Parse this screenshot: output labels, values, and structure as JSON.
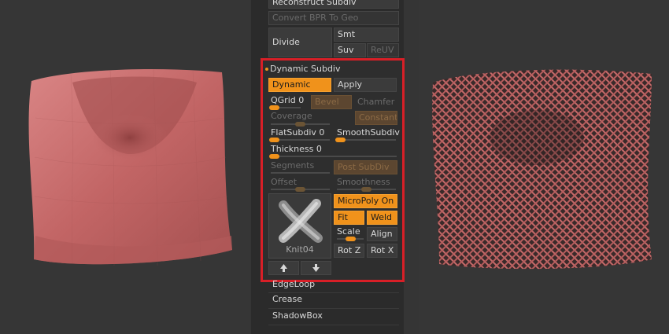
{
  "panel": {
    "top_items": [
      {
        "label": "Reconstruct Subdiv",
        "enabled": true
      },
      {
        "label": "Convert BPR To Geo",
        "enabled": false
      }
    ],
    "divide": {
      "label": "Divide",
      "smt": "Smt",
      "suv": "Suv",
      "reuv": "ReUV"
    },
    "dynamic_subdiv": {
      "title": "Dynamic Subdiv",
      "dynamic_label": "Dynamic",
      "apply_label": "Apply",
      "qgrid_label": "QGrid",
      "qgrid_value": "0",
      "bevel_label": "Bevel",
      "chamfer_label": "Chamfer",
      "coverage_label": "Coverage",
      "constant_label": "Constant",
      "flat_label": "FlatSubdiv",
      "flat_value": "0",
      "smooth_subdiv_label": "SmoothSubdiv",
      "thickness_label": "Thickness",
      "thickness_value": "0",
      "segments_label": "Segments",
      "post_subdiv_label": "Post SubDiv",
      "offset_label": "Offset",
      "smoothness_label": "Smoothness",
      "micropoly_label": "MicroPoly On",
      "fit_label": "Fit",
      "weld_label": "Weld",
      "scale_label": "Scale",
      "align_label": "Align",
      "rotz_label": "Rot Z",
      "rotx_label": "Rot X",
      "thumbnail_label": "Knit04",
      "up_icon": "arrow-up-icon",
      "down_icon": "arrow-down-icon"
    },
    "bottom_items": [
      {
        "label": "EdgeLoop"
      },
      {
        "label": "Crease"
      },
      {
        "label": "ShadowBox"
      }
    ]
  },
  "colors": {
    "accent": "#f0921b",
    "highlight_border": "#d81f27",
    "model": "#c46a6a"
  }
}
